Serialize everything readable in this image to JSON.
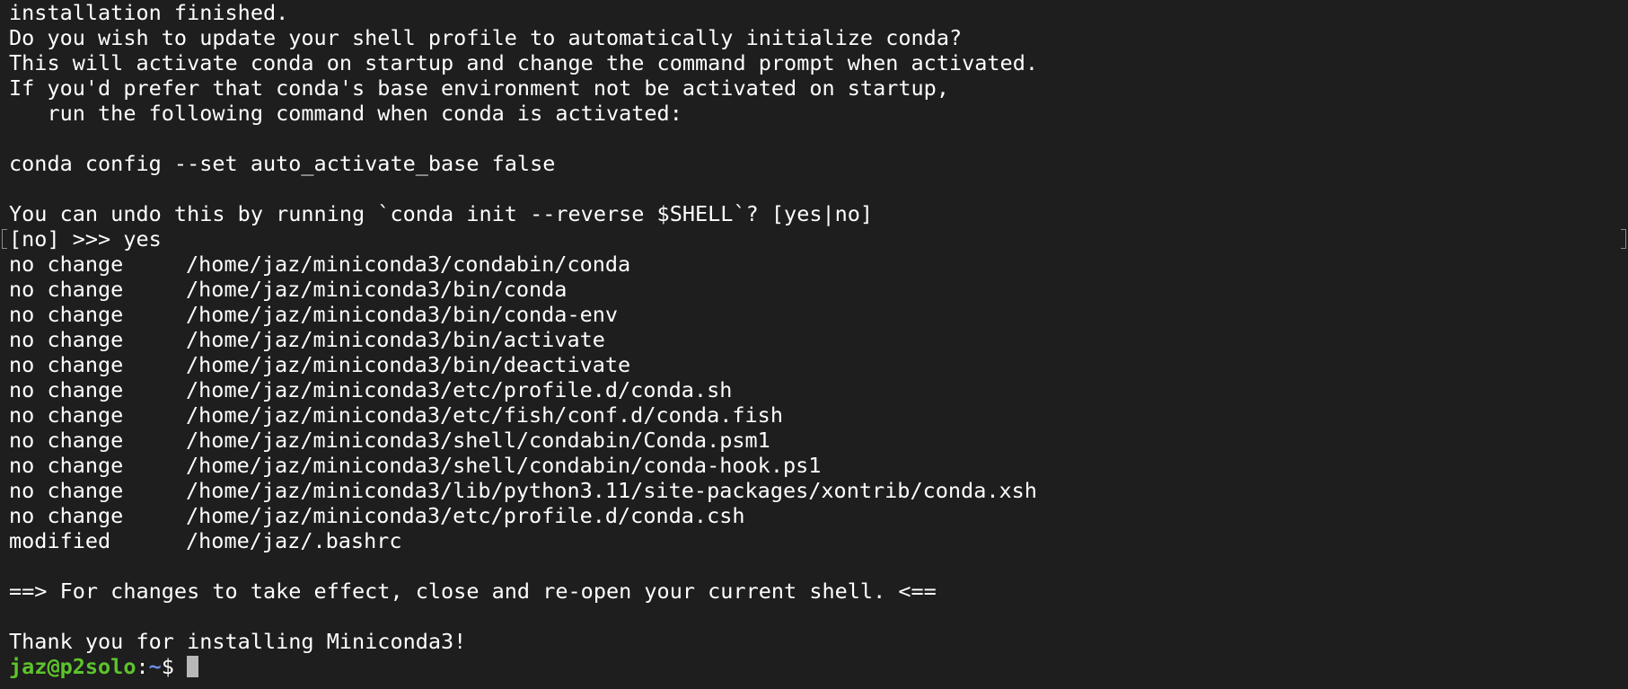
{
  "terminal": {
    "intro_lines": [
      "installation finished.",
      "Do you wish to update your shell profile to automatically initialize conda?",
      "This will activate conda on startup and change the command prompt when activated.",
      "If you'd prefer that conda's base environment not be activated on startup,",
      "   run the following command when conda is activated:"
    ],
    "config_command": "conda config --set auto_activate_base false",
    "undo_note": "You can undo this by running `conda init --reverse $SHELL`? [yes|no]",
    "answer_prompt": "[no] >>> ",
    "answer_value": "yes",
    "changes": [
      {
        "status": "no change",
        "path": "/home/jaz/miniconda3/condabin/conda"
      },
      {
        "status": "no change",
        "path": "/home/jaz/miniconda3/bin/conda"
      },
      {
        "status": "no change",
        "path": "/home/jaz/miniconda3/bin/conda-env"
      },
      {
        "status": "no change",
        "path": "/home/jaz/miniconda3/bin/activate"
      },
      {
        "status": "no change",
        "path": "/home/jaz/miniconda3/bin/deactivate"
      },
      {
        "status": "no change",
        "path": "/home/jaz/miniconda3/etc/profile.d/conda.sh"
      },
      {
        "status": "no change",
        "path": "/home/jaz/miniconda3/etc/fish/conf.d/conda.fish"
      },
      {
        "status": "no change",
        "path": "/home/jaz/miniconda3/shell/condabin/Conda.psm1"
      },
      {
        "status": "no change",
        "path": "/home/jaz/miniconda3/shell/condabin/conda-hook.ps1"
      },
      {
        "status": "no change",
        "path": "/home/jaz/miniconda3/lib/python3.11/site-packages/xontrib/conda.xsh"
      },
      {
        "status": "no change",
        "path": "/home/jaz/miniconda3/etc/profile.d/conda.csh"
      },
      {
        "status": "modified",
        "path": "/home/jaz/.bashrc"
      }
    ],
    "effect_note": "==> For changes to take effect, close and re-open your current shell. <==",
    "thanks": "Thank you for installing Miniconda3!",
    "prompt": {
      "user_host": "jaz@p2solo",
      "separator": ":",
      "cwd": "~",
      "symbol": "$"
    }
  },
  "colors": {
    "background": "#1e1e1e",
    "text": "#ffffff",
    "prompt_user": "#5dc42b",
    "prompt_path": "#6e8ce6",
    "cursor": "#b8b8b8"
  }
}
